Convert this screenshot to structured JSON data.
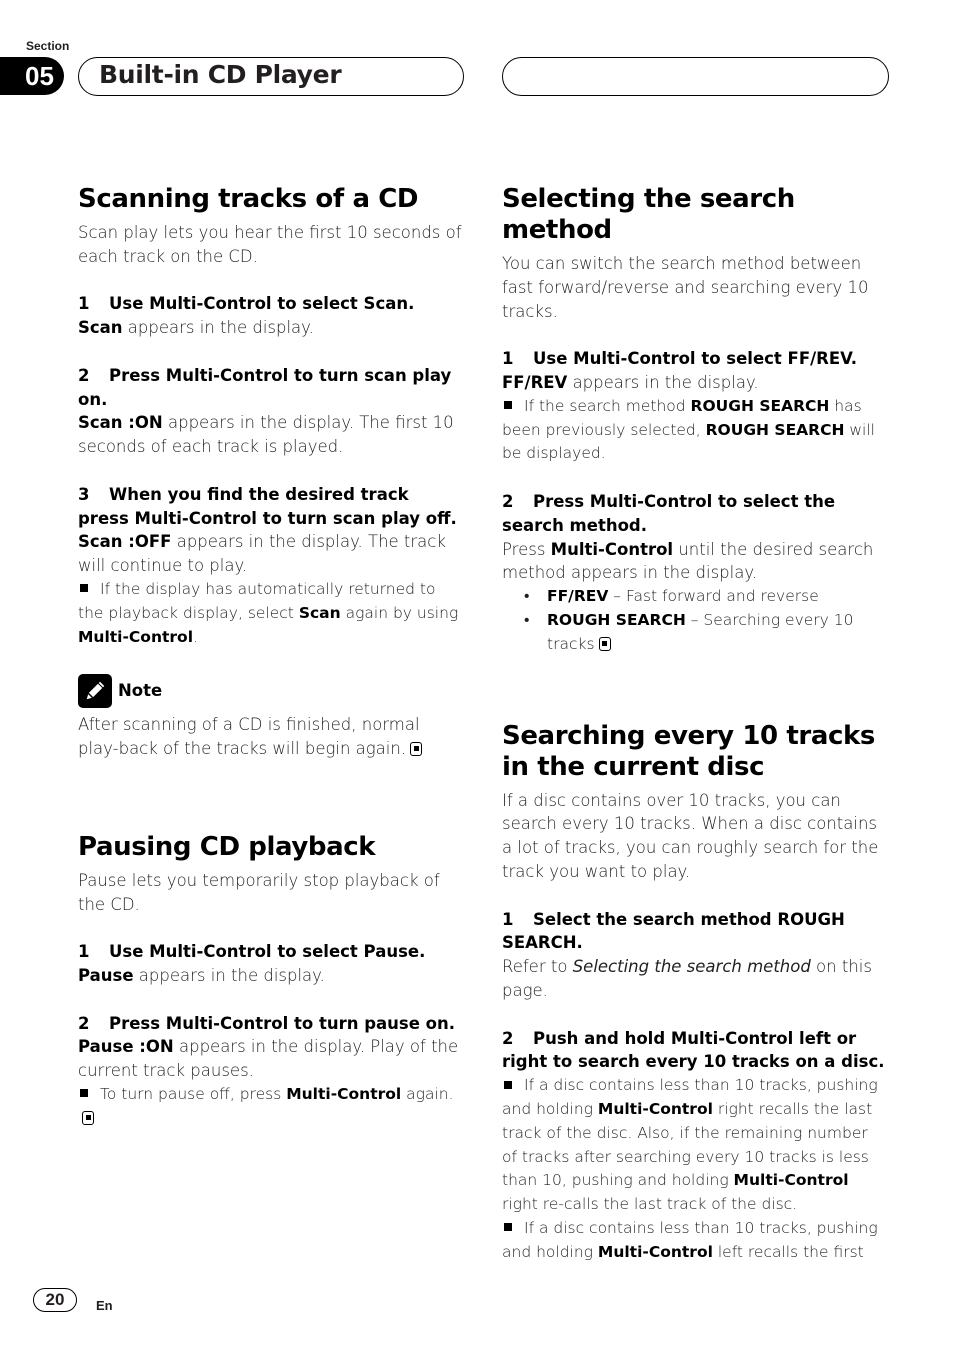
{
  "header": {
    "section_label": "Section",
    "section_number": "05",
    "section_title": "Built-in CD Player"
  },
  "left": {
    "scan": {
      "title": "Scanning tracks of a CD",
      "intro": "Scan play lets you hear the first 10 seconds of each track on the CD.",
      "steps": [
        {
          "num": "1",
          "text": "Use Multi-Control to select Scan.",
          "body_bold": "Scan",
          "body_rest": " appears in the display."
        },
        {
          "num": "2",
          "text": "Press Multi-Control to turn scan play on.",
          "body_bold": "Scan :ON",
          "body_rest": " appears in the display. The first 10 seconds of each track is played."
        },
        {
          "num": "3",
          "text": "When you find the desired track press Multi-Control to turn scan play off.",
          "body_bold": "Scan :OFF",
          "body_rest": " appears in the display. The track will continue to play."
        }
      ],
      "tip": {
        "pre": "If the display has automatically returned to the playback display, select ",
        "b1": "Scan",
        "mid": " again by using ",
        "b2": "Multi-Control",
        "post": "."
      }
    },
    "note": {
      "label": "Note",
      "icon": "pencil-icon",
      "text": "After scanning of a CD is finished, normal play-back of the tracks will begin again."
    },
    "pause": {
      "title": "Pausing CD playback",
      "intro": "Pause lets you temporarily stop playback of the CD.",
      "steps": [
        {
          "num": "1",
          "text": "Use Multi-Control to select Pause.",
          "body_bold": "Pause",
          "body_rest": " appears in the display."
        },
        {
          "num": "2",
          "text": "Press Multi-Control to turn pause on.",
          "body_bold": "Pause :ON",
          "body_rest": " appears in the display. Play of the current track pauses."
        }
      ],
      "tip": {
        "pre": "To turn pause off, press ",
        "b1": "Multi-Control",
        "post": " again."
      }
    }
  },
  "right": {
    "method": {
      "title": "Selecting the search method",
      "intro": "You can switch the search method between fast forward/reverse and searching every 10 tracks.",
      "step1": {
        "num": "1",
        "text": "Use Multi-Control to select FF/REV.",
        "body_bold": "FF/REV",
        "body_rest": " appears in the display."
      },
      "tip": {
        "pre": "If the search method ",
        "b1": "ROUGH SEARCH",
        "mid": " has been previously selected, ",
        "b2": "ROUGH SEARCH",
        "post": " will be displayed."
      },
      "step2": {
        "num": "2",
        "text": "Press Multi-Control to select the search method.",
        "pre": "Press ",
        "b": "Multi-Control",
        "post": " until the desired search method appears in the display."
      },
      "options": [
        {
          "name": "FF/REV",
          "desc": " – Fast forward and reverse"
        },
        {
          "name": "ROUGH SEARCH",
          "desc": " – Searching every 10 tracks"
        }
      ]
    },
    "rough": {
      "title": "Searching every 10 tracks in the current disc",
      "intro": "If a disc contains over 10 tracks, you can search every 10 tracks. When a disc contains a lot of tracks, you can roughly search for the track you want to play.",
      "step1": {
        "num": "1",
        "text": "Select the search method ROUGH SEARCH.",
        "pre": "Refer to ",
        "italic": "Selecting the search method",
        "post": " on this page."
      },
      "step2": {
        "num": "2",
        "text": "Push and hold Multi-Control left or right to search every 10 tracks on a disc."
      },
      "tip1": {
        "pre": "If a disc contains less than 10 tracks, pushing and holding ",
        "b1": "Multi-Control",
        "mid": " right recalls the last track of the disc. Also, if the remaining number of tracks after searching every 10 tracks is less than 10, pushing and holding ",
        "b2": "Multi-Control",
        "post": " right re-calls the last track of the disc."
      },
      "tip2": {
        "pre": "If a disc contains less than 10 tracks, pushing and holding ",
        "b1": "Multi-Control",
        "post": " left recalls the first"
      }
    }
  },
  "footer": {
    "page_number": "20",
    "language": "En"
  }
}
